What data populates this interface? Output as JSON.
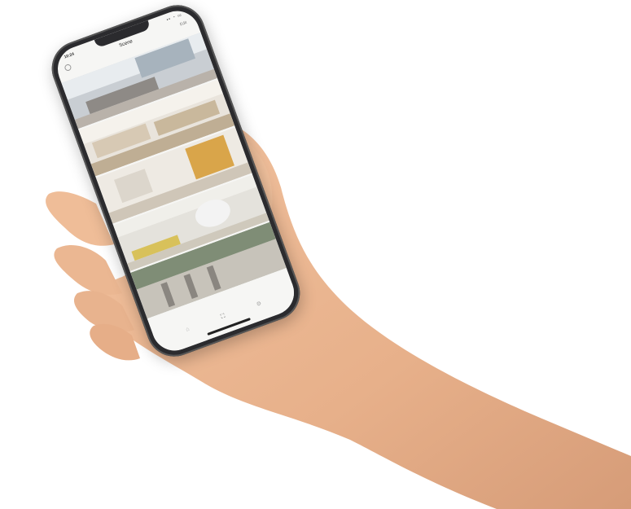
{
  "status_bar": {
    "time": "10:24",
    "icons": "▪▪ ◔ ▭"
  },
  "nav": {
    "title": "Scene",
    "subtitle": "",
    "right_action": "Edit"
  },
  "scenes": [
    {
      "label": ""
    },
    {
      "label": ""
    },
    {
      "label": ""
    },
    {
      "label": ""
    },
    {
      "label": ""
    }
  ],
  "tabs": [
    {
      "icon": "home-icon"
    },
    {
      "icon": "scene-icon"
    },
    {
      "icon": "settings-icon"
    }
  ],
  "colors": {
    "skin": "#e9b48f",
    "skin_shadow": "#c98b66",
    "bezel": "#2b2b2e",
    "screen_bg": "#f6f6f4"
  }
}
